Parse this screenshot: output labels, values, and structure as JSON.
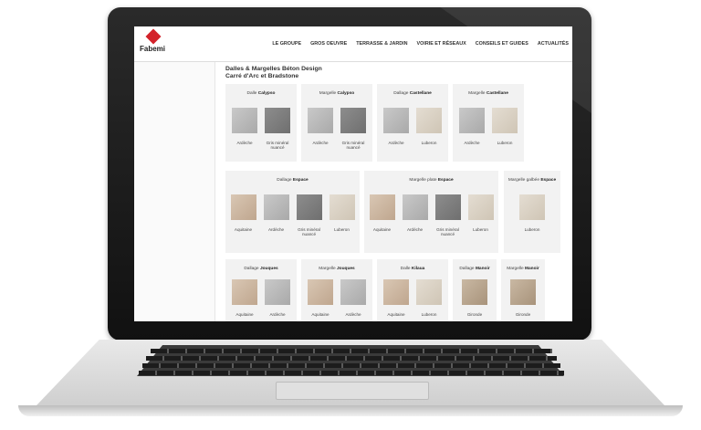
{
  "brand": {
    "name": "Fabemi"
  },
  "nav": {
    "items": [
      "LE GROUPE",
      "GROS OEUVRE",
      "TERRASSE & JARDIN",
      "VOIRIE ET RÉSEAUX",
      "CONSEILS ET GUIDES",
      "ACTUALITÉS"
    ]
  },
  "page": {
    "title_line1": "Dalles & Margelles Béton Design",
    "title_line2": "Carré d'Arc et Bradstone"
  },
  "colors": {
    "brand_red": "#d3222a",
    "card_bg": "#f2f2f2"
  },
  "cards": [
    {
      "prefix": "Dalle",
      "name": "Calypso",
      "swatches": [
        {
          "label": "Ardèche"
        },
        {
          "label": "Gris minéral nuancé"
        }
      ]
    },
    {
      "prefix": "Margelle",
      "name": "Calypso",
      "swatches": [
        {
          "label": "Ardèche"
        },
        {
          "label": "Gris minéral nuancé"
        }
      ]
    },
    {
      "prefix": "Dallage",
      "name": "Castellane",
      "swatches": [
        {
          "label": "Ardèche"
        },
        {
          "label": "Luberon"
        }
      ]
    },
    {
      "prefix": "Margelle",
      "name": "Castellane",
      "swatches": [
        {
          "label": "Ardèche"
        },
        {
          "label": "Luberon"
        }
      ]
    },
    {
      "prefix": "Dallage",
      "name": "Espace",
      "swatches": [
        {
          "label": "Aquitaine"
        },
        {
          "label": "Ardèche"
        },
        {
          "label": "Gris minéral nuancé"
        },
        {
          "label": "Luberon"
        }
      ]
    },
    {
      "prefix": "Margelle plate",
      "name": "Espace",
      "swatches": [
        {
          "label": "Aquitaine"
        },
        {
          "label": "Ardèche"
        },
        {
          "label": "Gris minéral nuancé"
        },
        {
          "label": "Luberon"
        }
      ]
    },
    {
      "prefix": "Margelle galbée",
      "name": "Espace",
      "swatches": [
        {
          "label": "Luberon"
        }
      ]
    },
    {
      "prefix": "Dallage",
      "name": "Jouques",
      "swatches": [
        {
          "label": "Aquitaine"
        },
        {
          "label": "Ardèche"
        }
      ]
    },
    {
      "prefix": "Margelle",
      "name": "Jouques",
      "swatches": [
        {
          "label": "Aquitaine"
        },
        {
          "label": "Ardèche"
        }
      ]
    },
    {
      "prefix": "Dalle",
      "name": "Kilaua",
      "swatches": [
        {
          "label": "Aquitaine"
        },
        {
          "label": "Luberon"
        }
      ]
    },
    {
      "prefix": "Dallage",
      "name": "Manoir",
      "swatches": [
        {
          "label": "Gironde"
        }
      ]
    },
    {
      "prefix": "Margelle",
      "name": "Manoir",
      "swatches": [
        {
          "label": "Gironde"
        }
      ]
    }
  ]
}
